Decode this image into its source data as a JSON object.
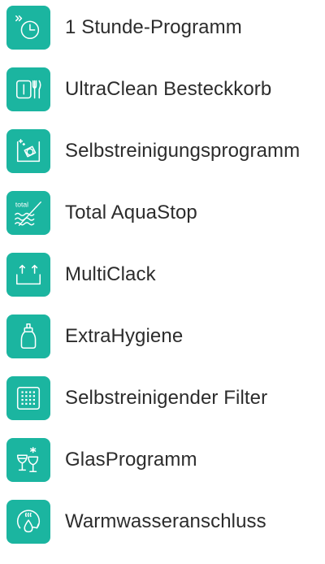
{
  "theme": {
    "tile_color": "#1bb5a0",
    "label_color": "#2c2c2c",
    "background": "#ffffff"
  },
  "features": [
    {
      "label": "1 Stunde-Programm",
      "icon": "one-hour-clock-icon"
    },
    {
      "label": "UltraClean Besteckkorb",
      "icon": "cutlery-basket-icon"
    },
    {
      "label": "Selbstreinigungsprogramm",
      "icon": "self-cleaning-drum-icon"
    },
    {
      "label": "Total AquaStop",
      "icon": "total-aquastop-icon"
    },
    {
      "label": "MultiClack",
      "icon": "multiclack-basket-icon"
    },
    {
      "label": "ExtraHygiene",
      "icon": "baby-bottle-icon"
    },
    {
      "label": "Selbstreinigender Filter",
      "icon": "filter-grid-icon"
    },
    {
      "label": "GlasProgramm",
      "icon": "wine-glasses-icon"
    },
    {
      "label": "Warmwasseranschluss",
      "icon": "hot-water-icon"
    }
  ]
}
